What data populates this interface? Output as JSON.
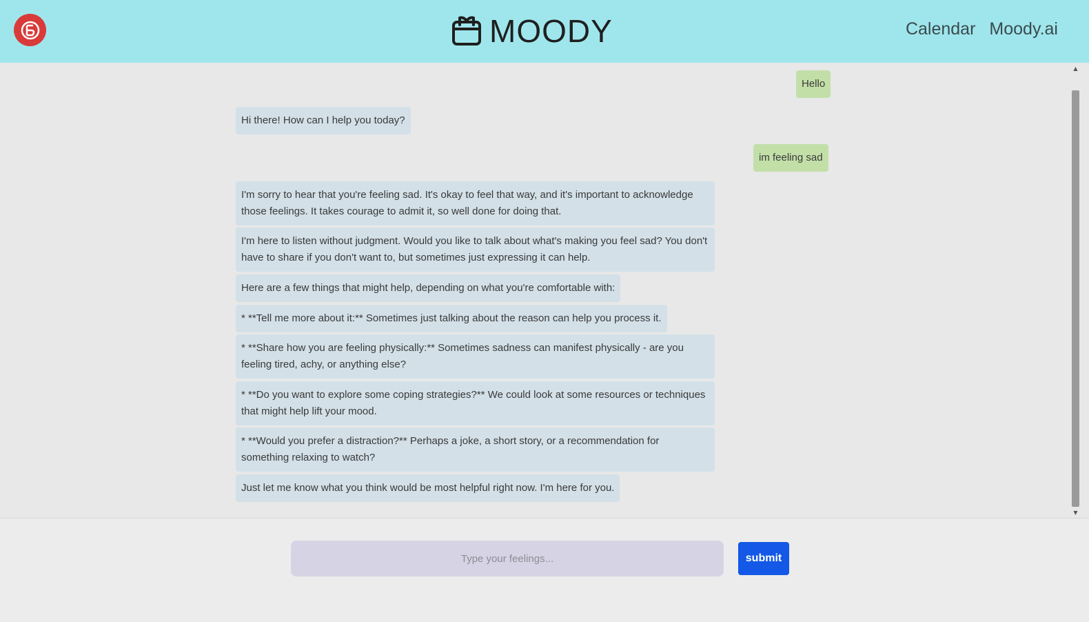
{
  "header": {
    "brand_title": "MOODY",
    "nav": [
      "Calendar",
      "Moody.ai"
    ],
    "logo_icon": "brand-logo-icon",
    "brand_icon": "calendar-icon"
  },
  "chat": {
    "messages": [
      {
        "role": "user",
        "text": "Hello"
      },
      {
        "role": "bot",
        "text": "Hi there! How can I help you today?"
      },
      {
        "role": "user",
        "text": "im feeling sad"
      },
      {
        "role": "bot",
        "text": "I'm sorry to hear that you're feeling sad. It's okay to feel that way, and it's important to acknowledge those feelings. It takes courage to admit it, so well done for doing that."
      },
      {
        "role": "bot",
        "text": "I'm here to listen without judgment. Would you like to talk about what's making you feel sad? You don't have to share if you don't want to, but sometimes just expressing it can help."
      },
      {
        "role": "bot",
        "text": "Here are a few things that might help, depending on what you're comfortable with:"
      },
      {
        "role": "bot",
        "text": "* **Tell me more about it:** Sometimes just talking about the reason can help you process it."
      },
      {
        "role": "bot",
        "text": "* **Share how you are feeling physically:** Sometimes sadness can manifest physically - are you feeling tired, achy, or anything else?"
      },
      {
        "role": "bot",
        "text": "* **Do you want to explore some coping strategies?** We could look at some resources or techniques that might help lift your mood."
      },
      {
        "role": "bot",
        "text": "* **Would you prefer a distraction?** Perhaps a joke, a short story, or a recommendation for something relaxing to watch?"
      },
      {
        "role": "bot",
        "text": "Just let me know what you think would be most helpful right now. I'm here for you."
      }
    ]
  },
  "input": {
    "placeholder": "Type your feelings...",
    "value": ""
  },
  "submit_label": "submit",
  "colors": {
    "header_bg": "#9fe6ec",
    "user_bubble": "#c3dfa8",
    "bot_bubble": "#d3e0e8",
    "submit_bg": "#1358e6",
    "input_bg": "#d6d4e4"
  }
}
